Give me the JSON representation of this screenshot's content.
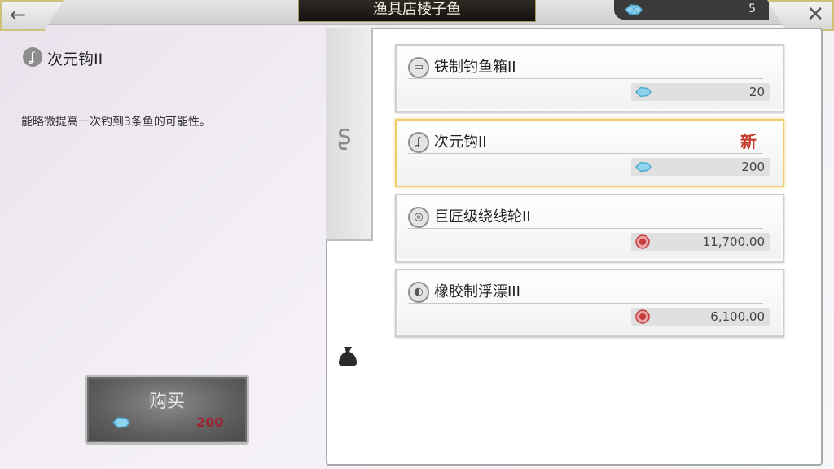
{
  "header": {
    "title": "渔具店棱子鱼",
    "currency_amount": "5",
    "back_icon": "arrow-left-icon",
    "close_icon": "close-icon"
  },
  "detail": {
    "name": "次元钩II",
    "description": "能略微提高一次钓到3条鱼的可能性。"
  },
  "buy": {
    "label": "购买",
    "price": "200"
  },
  "items": [
    {
      "name": "铁制钓鱼箱II",
      "price": "20",
      "currency": "fish-gem",
      "new": ""
    },
    {
      "name": "次元钩II",
      "price": "200",
      "currency": "fish-gem",
      "new": "新"
    },
    {
      "name": "巨匠级绕线轮II",
      "price": "11,700.00",
      "currency": "red-coin",
      "new": ""
    },
    {
      "name": "橡胶制浮漂III",
      "price": "6,100.00",
      "currency": "red-coin",
      "new": ""
    }
  ],
  "colors": {
    "selected_border": "#f1cc6a",
    "new_badge": "#c5382c",
    "buy_price": "#9b2430"
  }
}
